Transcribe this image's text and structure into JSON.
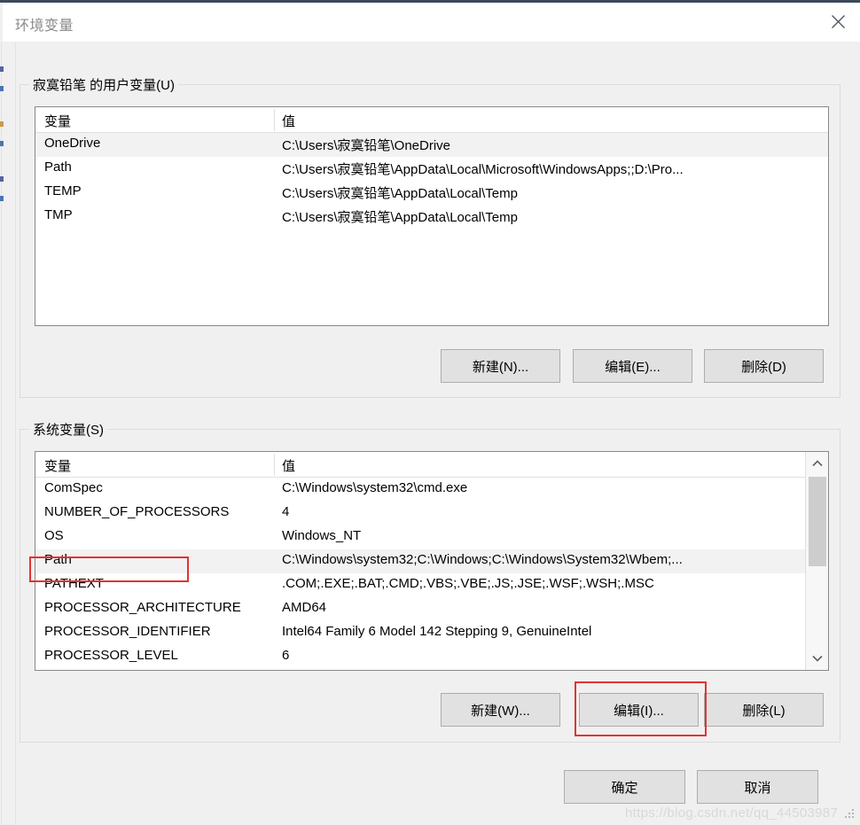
{
  "window": {
    "title": "环境变量",
    "close_icon": "close-icon"
  },
  "user_section": {
    "legend": "寂寞铅笔 的用户变量(U)",
    "columns": [
      "变量",
      "值"
    ],
    "rows": [
      {
        "name": "OneDrive",
        "value": "C:\\Users\\寂寞铅笔\\OneDrive",
        "selected": true
      },
      {
        "name": "Path",
        "value": "C:\\Users\\寂寞铅笔\\AppData\\Local\\Microsoft\\WindowsApps;;D:\\Pro...",
        "selected": false
      },
      {
        "name": "TEMP",
        "value": "C:\\Users\\寂寞铅笔\\AppData\\Local\\Temp",
        "selected": false
      },
      {
        "name": "TMP",
        "value": "C:\\Users\\寂寞铅笔\\AppData\\Local\\Temp",
        "selected": false
      }
    ],
    "buttons": {
      "new": "新建(N)...",
      "edit": "编辑(E)...",
      "delete": "删除(D)"
    }
  },
  "system_section": {
    "legend": "系统变量(S)",
    "columns": [
      "变量",
      "值"
    ],
    "rows": [
      {
        "name": "ComSpec",
        "value": "C:\\Windows\\system32\\cmd.exe",
        "selected": false
      },
      {
        "name": "NUMBER_OF_PROCESSORS",
        "value": "4",
        "selected": false
      },
      {
        "name": "OS",
        "value": "Windows_NT",
        "selected": false
      },
      {
        "name": "Path",
        "value": "C:\\Windows\\system32;C:\\Windows;C:\\Windows\\System32\\Wbem;...",
        "selected": true
      },
      {
        "name": "PATHEXT",
        "value": ".COM;.EXE;.BAT;.CMD;.VBS;.VBE;.JS;.JSE;.WSF;.WSH;.MSC",
        "selected": false
      },
      {
        "name": "PROCESSOR_ARCHITECTURE",
        "value": "AMD64",
        "selected": false
      },
      {
        "name": "PROCESSOR_IDENTIFIER",
        "value": "Intel64 Family 6 Model 142 Stepping 9, GenuineIntel",
        "selected": false
      },
      {
        "name": "PROCESSOR_LEVEL",
        "value": "6",
        "selected": false
      }
    ],
    "buttons": {
      "new": "新建(W)...",
      "edit": "编辑(I)...",
      "delete": "删除(L)"
    },
    "scrollbar": {
      "up_icon": "chevron-up-icon",
      "down_icon": "chevron-down-icon"
    }
  },
  "dialog_buttons": {
    "ok": "确定",
    "cancel": "取消"
  },
  "annotations": {
    "highlight_color": "#e33232",
    "highlighted_row": "Path",
    "highlighted_button": "编辑(I)..."
  },
  "watermark": {
    "text": "https://blog.csdn.net/qq_44503987"
  }
}
